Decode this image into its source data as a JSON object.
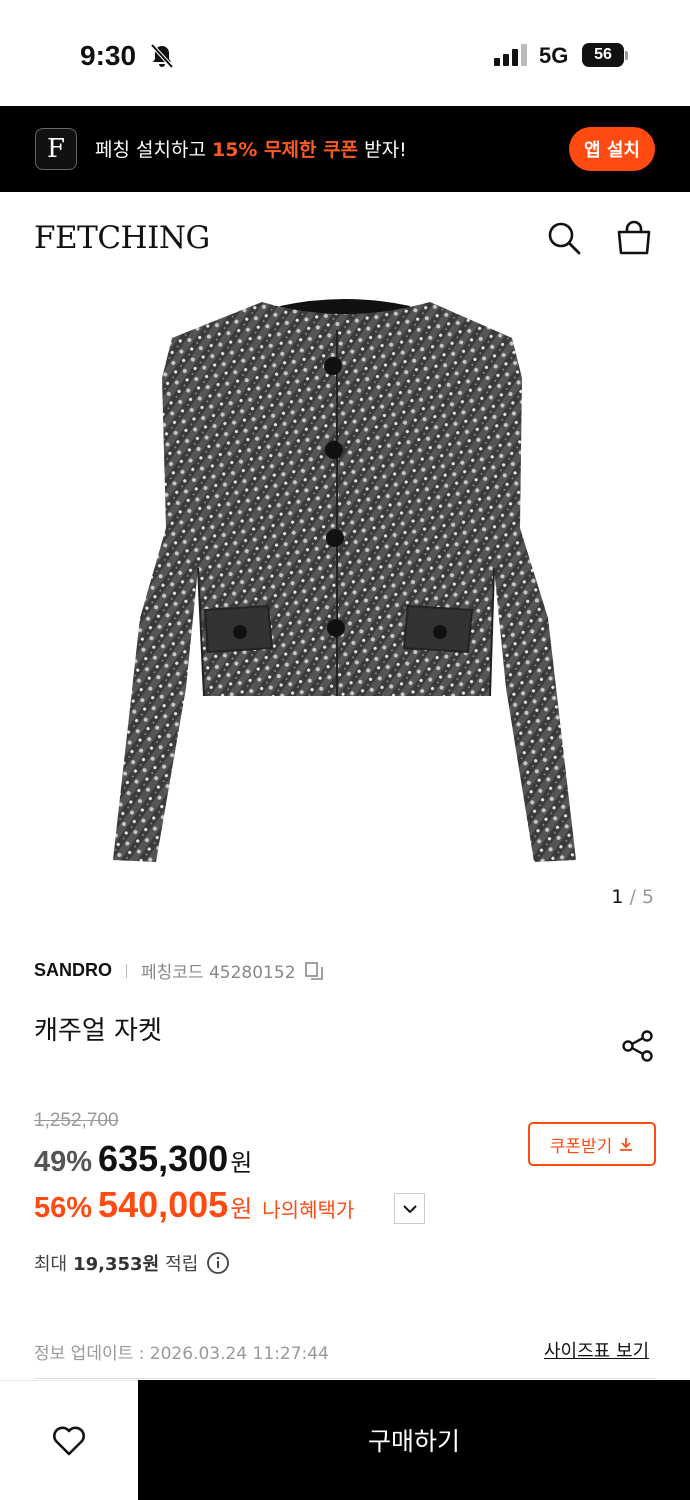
{
  "status_bar": {
    "time": "9:30",
    "network": "5G",
    "battery": "56"
  },
  "promo_banner": {
    "logo_letter": "F",
    "text_before": "페칭 설치하고 ",
    "text_highlight": "15% 무제한 쿠폰",
    "text_after": " 받자!",
    "install_label": "앱 설치",
    "accent_color": "#ff4a12"
  },
  "header": {
    "brand": "FETCHING",
    "search_icon": "search-icon",
    "bag_icon": "shopping-bag-icon"
  },
  "gallery": {
    "current": "1",
    "separator": " / ",
    "total": "5"
  },
  "product": {
    "brand": "SANDRO",
    "code_label": "페칭코드 45280152",
    "name": "캐주얼 자켓",
    "original_price": "1,252,700",
    "discount1": "49%",
    "price1": "635,300",
    "won": "원",
    "discount2": "56%",
    "price2": "540,005",
    "my_benefit": "나의혜택가",
    "coupon_label": "쿠폰받기",
    "points_prefix": "최대",
    "points_amount": "19,353원",
    "points_suffix": "적립",
    "updated": "정보 업데이트 : 2026.03.24 11:27:44",
    "size_chart": "사이즈표 보기"
  },
  "bottom_bar": {
    "buy_label": "구매하기"
  }
}
